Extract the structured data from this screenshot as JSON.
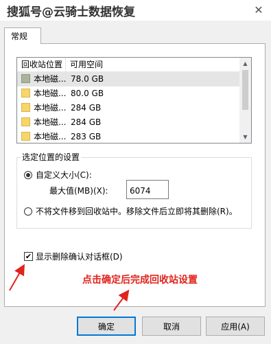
{
  "window": {
    "title": "搜狐号@云骑士数据恢复",
    "close_glyph": "✕"
  },
  "tabs": [
    {
      "label": "常规",
      "selected": true
    }
  ],
  "recycle_list": {
    "columns": [
      "回收站位置",
      "可用空间"
    ],
    "rows": [
      {
        "name": "本地磁...",
        "space": "78.0 GB",
        "selected": true
      },
      {
        "name": "本地磁...",
        "space": "80.0 GB",
        "selected": false
      },
      {
        "name": "本地磁...",
        "space": "284 GB",
        "selected": false
      },
      {
        "name": "本地磁...",
        "space": "284 GB",
        "selected": false
      },
      {
        "name": "本地磁...",
        "space": "283 GB",
        "selected": false
      }
    ],
    "scroll_up_glyph": "▲",
    "scroll_down_glyph": "▼"
  },
  "settings": {
    "group_title": "选定位置的设置",
    "custom_size_label": "自定义大小(C):",
    "custom_size_checked": true,
    "max_size_label": "最大值(MB)(X):",
    "max_size_value": "6074",
    "no_move_label": "不将文件移到回收站中。移除文件后立即将其删除(R)。",
    "no_move_checked": false
  },
  "confirm_dialog": {
    "label": "显示删除确认对话框(D)",
    "checked": true,
    "check_glyph": "✔"
  },
  "annotation": {
    "text": "点击确定后完成回收站设置",
    "color": "#e0231c"
  },
  "buttons": {
    "ok": "确定",
    "cancel": "取消",
    "apply": "应用(A)"
  },
  "colors": {
    "accent": "#0078d7",
    "arrow": "#e0231c"
  }
}
